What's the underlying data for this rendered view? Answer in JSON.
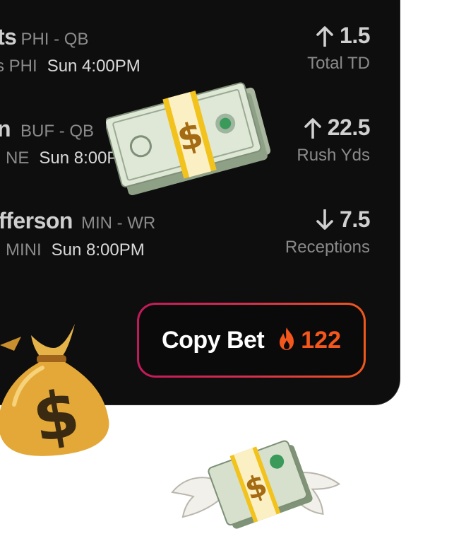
{
  "picks": [
    {
      "player": "ts",
      "position": "PHI - QB",
      "team": "s PHI",
      "time": "Sun 4:00PM",
      "direction": "up",
      "value": "1.5",
      "stat": "Total TD"
    },
    {
      "player": "n",
      "position": "BUF - QB",
      "team": "NE",
      "time": "Sun 8:00PM",
      "direction": "up",
      "value": "22.5",
      "stat": "Rush Yds"
    },
    {
      "player": "fferson",
      "position": "MIN - WR",
      "team": "MINI",
      "time": "Sun 8:00PM",
      "direction": "down",
      "value": "7.5",
      "stat": "Receptions"
    }
  ],
  "copy_bet": {
    "label": "Copy Bet",
    "count": "122",
    "icon": "fire-icon"
  },
  "decorations": [
    "money-stack-icon",
    "money-bag-icon",
    "money-with-wings-icon"
  ],
  "colors": {
    "card": "#0e0e0e",
    "accent_orange": "#f4571c",
    "accent_pink": "#c2195a"
  }
}
